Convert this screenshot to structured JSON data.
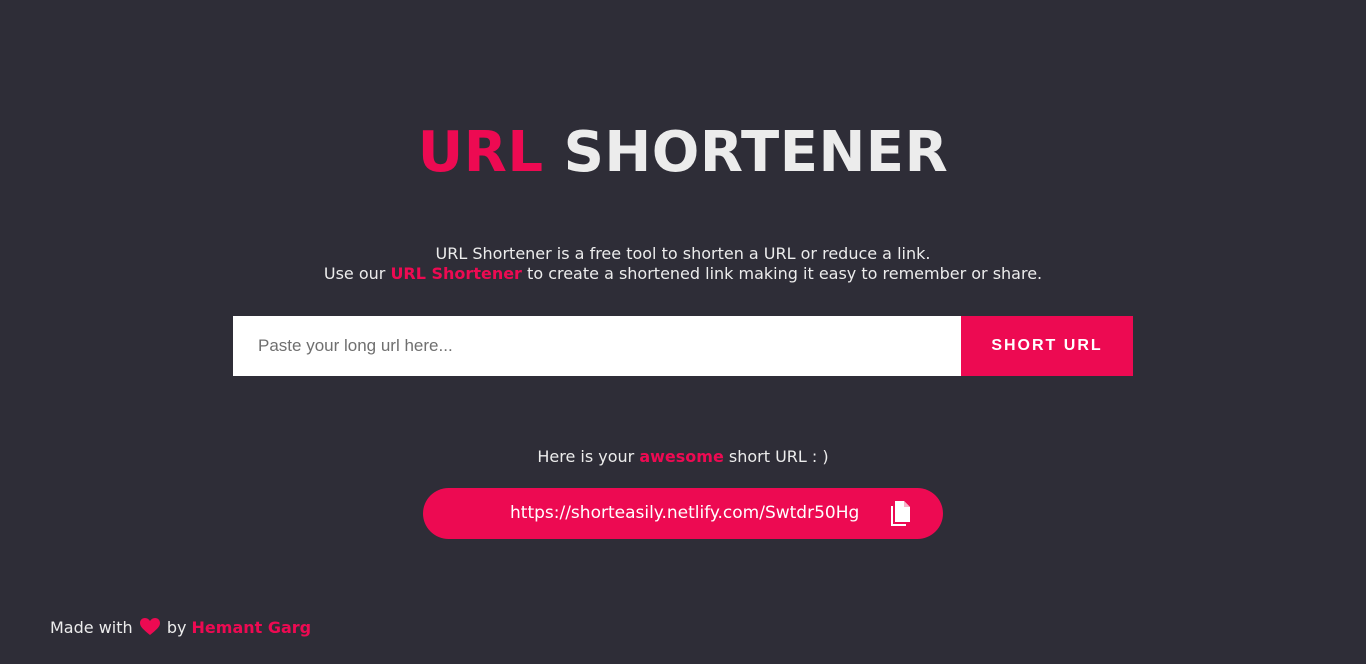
{
  "title": {
    "accent": "URL",
    "main": "SHORTENER"
  },
  "description": {
    "line1": "URL Shortener is a free tool to shorten a URL or reduce a link.",
    "line2_prefix": "Use our ",
    "line2_accent": "URL Shortener",
    "line2_suffix": " to create a shortened link making it easy to remember or share."
  },
  "form": {
    "input_placeholder": "Paste your long url here...",
    "input_value": "",
    "button_label": "SHORT URL"
  },
  "result": {
    "label_prefix": "Here is your ",
    "label_accent": "awesome",
    "label_suffix": " short URL : )",
    "short_url": "https://shorteasily.netlify.com/Swtdr50Hg",
    "copy_icon": "copy-icon"
  },
  "footer": {
    "prefix": "Made with ",
    "heart_icon": "heart-icon",
    "by": " by ",
    "author": "Hemant Garg"
  },
  "colors": {
    "background": "#2e2d37",
    "accent": "#ed0a52",
    "text": "#ececec"
  }
}
